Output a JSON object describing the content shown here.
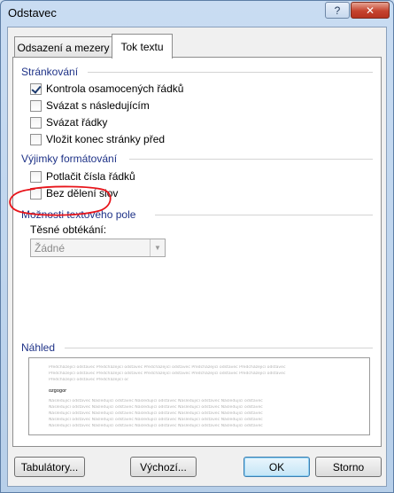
{
  "window": {
    "title": "Odstavec",
    "help_label": "?",
    "close_label": "✕"
  },
  "tabs": [
    {
      "label": "Odsazení a mezery",
      "selected": false
    },
    {
      "label": "Tok textu",
      "selected": true
    }
  ],
  "pagination": {
    "heading": "Stránkování",
    "options": [
      {
        "label": "Kontrola osamocených řádků",
        "checked": true
      },
      {
        "label": "Svázat s následujícím",
        "checked": false
      },
      {
        "label": "Svázat řádky",
        "checked": false
      },
      {
        "label": "Vložit konec stránky před",
        "checked": false
      }
    ]
  },
  "formatting_exceptions": {
    "heading": "Výjimky formátování",
    "options": [
      {
        "label": "Potlačit čísla řádků",
        "checked": false
      },
      {
        "label": "Bez dělení slov",
        "checked": false
      }
    ]
  },
  "textbox_options": {
    "heading": "Možnosti textového pole",
    "tight_wrap_label": "Těsné obtékání:",
    "tight_wrap_value": "Žádné"
  },
  "preview": {
    "heading": "Náhled",
    "prev_text": "Předcházející odstavec Předcházející odstavec Předcházející odstavec Předcházející odstavec Předcházející odstavec",
    "sample_text": "ozgogor",
    "next_text": "Následující odstavec Následující odstavec Následující odstavec Následující odstavec Následující odstavec"
  },
  "buttons": {
    "tabs_label": "Tabulátory...",
    "default_label": "Výchozí...",
    "ok_label": "OK",
    "cancel_label": "Storno"
  },
  "colors": {
    "section_heading": "#1e3287",
    "annotation": "#e8141a"
  }
}
